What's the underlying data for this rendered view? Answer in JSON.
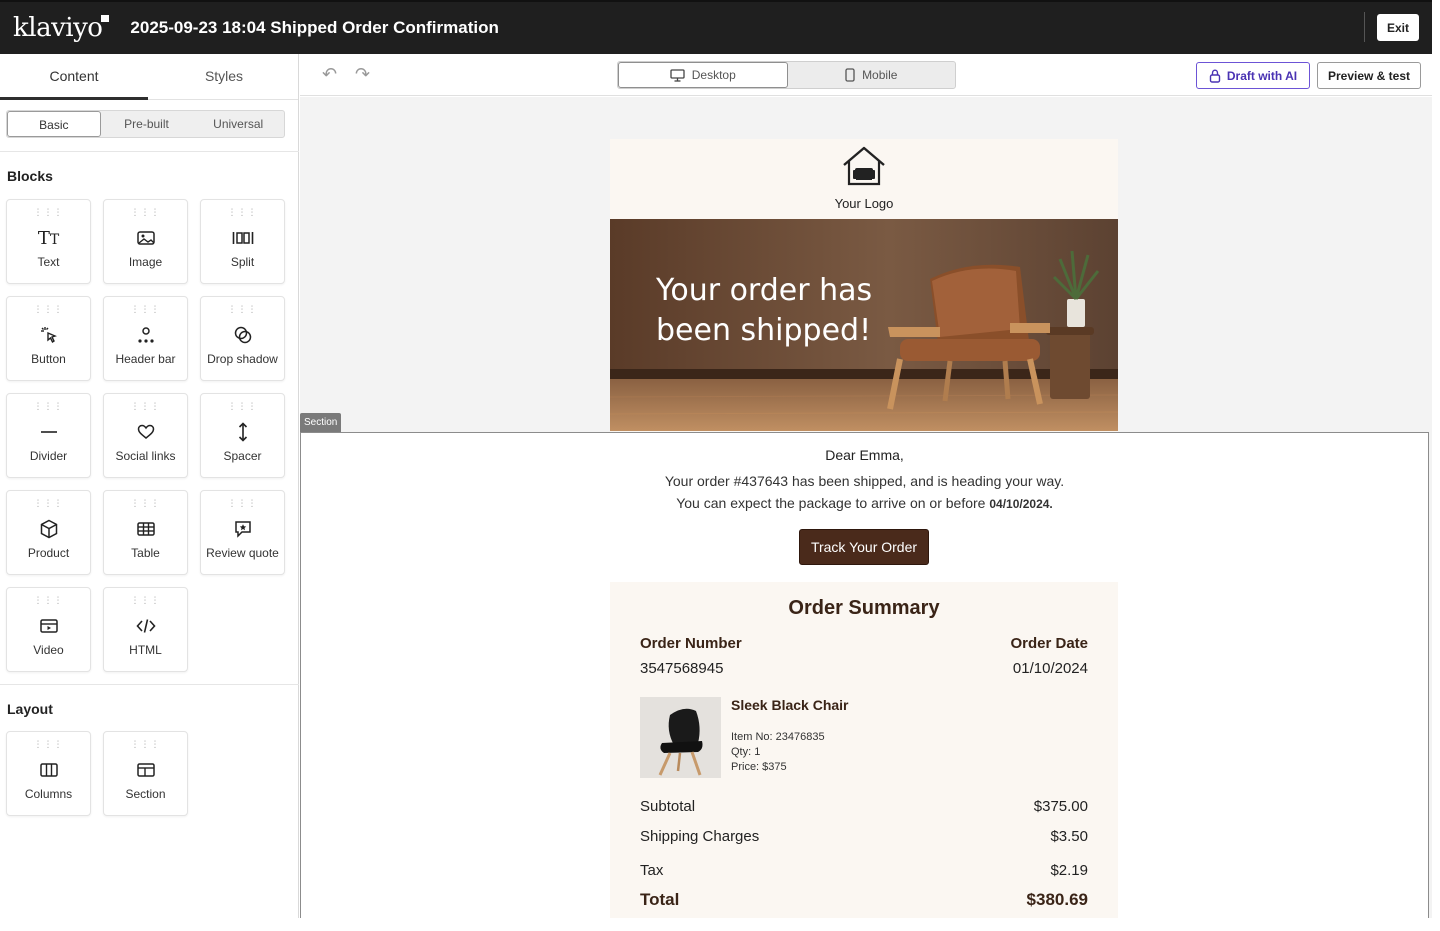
{
  "app": {
    "brand": "klaviyo",
    "title": "2025-09-23 18:04 Shipped Order Confirmation",
    "exit_label": "Exit"
  },
  "left_panel": {
    "tabs": [
      {
        "label": "Content"
      },
      {
        "label": "Styles"
      }
    ],
    "segments": [
      {
        "label": "Basic"
      },
      {
        "label": "Pre-built"
      },
      {
        "label": "Universal"
      }
    ],
    "blocks_title": "Blocks",
    "blocks": [
      {
        "label": "Text",
        "icon": "text-icon"
      },
      {
        "label": "Image",
        "icon": "image-icon"
      },
      {
        "label": "Split",
        "icon": "split-icon"
      },
      {
        "label": "Button",
        "icon": "button-icon"
      },
      {
        "label": "Header bar",
        "icon": "header-bar-icon"
      },
      {
        "label": "Drop shadow",
        "icon": "drop-shadow-icon"
      },
      {
        "label": "Divider",
        "icon": "divider-icon"
      },
      {
        "label": "Social links",
        "icon": "heart-icon"
      },
      {
        "label": "Spacer",
        "icon": "spacer-icon"
      },
      {
        "label": "Product",
        "icon": "product-icon"
      },
      {
        "label": "Table",
        "icon": "table-icon"
      },
      {
        "label": "Review quote",
        "icon": "review-quote-icon"
      },
      {
        "label": "Video",
        "icon": "video-icon"
      },
      {
        "label": "HTML",
        "icon": "code-icon"
      }
    ],
    "layout_title": "Layout",
    "layout": [
      {
        "label": "Columns",
        "icon": "columns-icon"
      },
      {
        "label": "Section",
        "icon": "section-icon"
      }
    ]
  },
  "toolbar": {
    "device_desktop": "Desktop",
    "device_mobile": "Mobile",
    "draft_label": "Draft with AI",
    "preview_label": "Preview & test"
  },
  "email": {
    "logo_text": "Your Logo",
    "hero_text": "Your order has been shipped!",
    "section_tag": "Section",
    "greeting": "Dear Emma,",
    "message_line1": "Your order #437643 has been shipped, and is heading your way.",
    "message_line2_prefix": "You can expect the package to arrive on or before ",
    "message_date": "04/10/2024.",
    "track_button": "Track Your Order",
    "summary": {
      "title": "Order Summary",
      "order_number_label": "Order Number",
      "order_number": "3547568945",
      "order_date_label": "Order Date",
      "order_date": "01/10/2024",
      "product_name": "Sleek Black Chair",
      "item_no": "Item No: 23476835",
      "qty": "Qty: 1",
      "price": "Price: $375",
      "subtotal_label": "Subtotal",
      "subtotal": "$375.00",
      "shipping_label": "Shipping Charges",
      "shipping": "$3.50",
      "tax_label": "Tax",
      "tax": "$2.19",
      "total_label": "Total",
      "total": "$380.69"
    }
  },
  "colors": {
    "topbar": "#1f1f1f",
    "accent_purple": "#6c54d6",
    "brown_button": "#4a2a1b",
    "cream": "#fbf7f2"
  }
}
